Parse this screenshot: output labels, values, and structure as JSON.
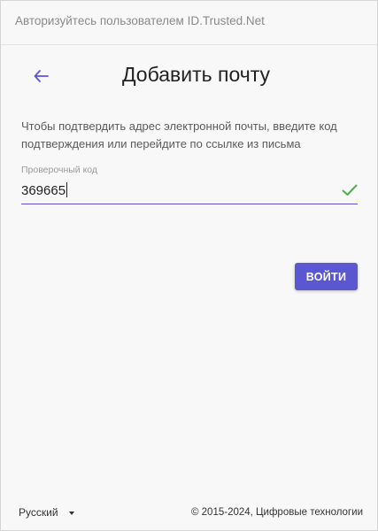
{
  "header": {
    "title": "Авторизуйтесь пользователем ID.Trusted.Net"
  },
  "page": {
    "title": "Добавить почту",
    "instruction": "Чтобы подтвердить адрес электронной почты, введите код подтверждения или перейдите по ссылке из письма"
  },
  "code_field": {
    "label": "Проверочный код",
    "value": "369665",
    "valid": true
  },
  "actions": {
    "submit_label": "ВОЙТИ"
  },
  "footer": {
    "language": "Русский",
    "copyright": "© 2015-2024, Цифровые технологии"
  },
  "colors": {
    "accent": "#5b57cf",
    "success": "#4caf50"
  },
  "icons": {
    "back": "arrow-left-icon",
    "valid": "check-icon",
    "language_dropdown": "caret-down-icon"
  }
}
